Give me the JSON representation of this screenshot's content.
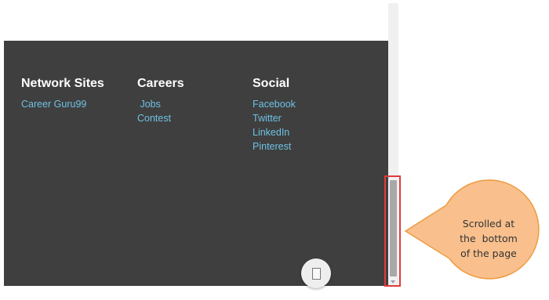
{
  "footer": {
    "columns": [
      {
        "heading": "Network Sites",
        "links": [
          "Career Guru99"
        ]
      },
      {
        "heading": "Careers",
        "links": [
          " Jobs",
          "Contest"
        ]
      },
      {
        "heading": "Social",
        "links": [
          "Facebook",
          "Twitter",
          "LinkedIn",
          "Pinterest"
        ]
      }
    ],
    "background_color": "#3f3f3f",
    "link_color": "#6ec1e4"
  },
  "scroll_top_button": {
    "icon": "scroll-to-top-icon"
  },
  "annotation": {
    "text_lines": [
      "Scrolled at",
      "the  bottom",
      "of the page"
    ],
    "highlight_color": "#e23b3b",
    "callout_fill": "#f9c08d",
    "callout_stroke": "#ef9a3f"
  }
}
